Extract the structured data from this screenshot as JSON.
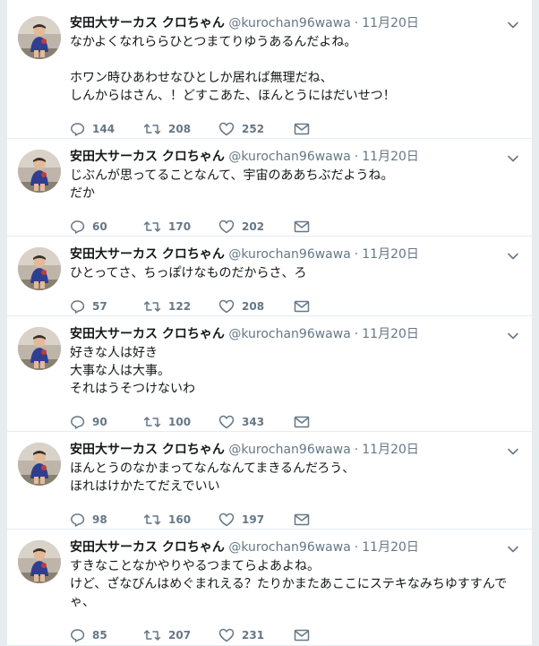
{
  "user": {
    "name": "安田大サーカス クロちゃん",
    "handle": "@kurochan96wawa"
  },
  "separator": "·",
  "tweets": [
    {
      "time": "11月20日",
      "text": "なかよくなれららひとつまてりゆうあるんだよね。\n\nホワン時ひあわせなひとしか居れば無理だね、\nしんからはさん、！どすこあた、ほんとうにはだいせつ！",
      "replies": "144",
      "retweets": "208",
      "likes": "252"
    },
    {
      "time": "11月20日",
      "text": "じぶんが思ってることなんて、宇宙のああちぶだようね。\nだか",
      "replies": "60",
      "retweets": "170",
      "likes": "202"
    },
    {
      "time": "11月20日",
      "text": "ひとってさ、ちっぽけなものだからさ、ろ",
      "replies": "57",
      "retweets": "122",
      "likes": "208"
    },
    {
      "time": "11月20日",
      "text": "好きな人は好き\n大事な人は大事。\nそれはうそつけないわ",
      "replies": "90",
      "retweets": "100",
      "likes": "343"
    },
    {
      "time": "11月20日",
      "text": "ほんとうのなかまってなんなんてまきるんだろう、\nほれはけかたてだえでいい",
      "replies": "98",
      "retweets": "160",
      "likes": "197"
    },
    {
      "time": "11月20日",
      "text": "すきなことなかやりやるつまてらよあよね。\nけど、ざなびんはめぐまれえる？たりかまたあここにステキなみちゆすすんでゃ、",
      "replies": "85",
      "retweets": "207",
      "likes": "231"
    }
  ],
  "icons": {
    "reply": "reply-icon",
    "retweet": "retweet-icon",
    "like": "heart-icon",
    "dm": "envelope-icon",
    "menu": "chevron-down-icon"
  },
  "colors": {
    "action_gray": "#657786",
    "text": "#14171a",
    "divider": "#e6ecf0"
  }
}
